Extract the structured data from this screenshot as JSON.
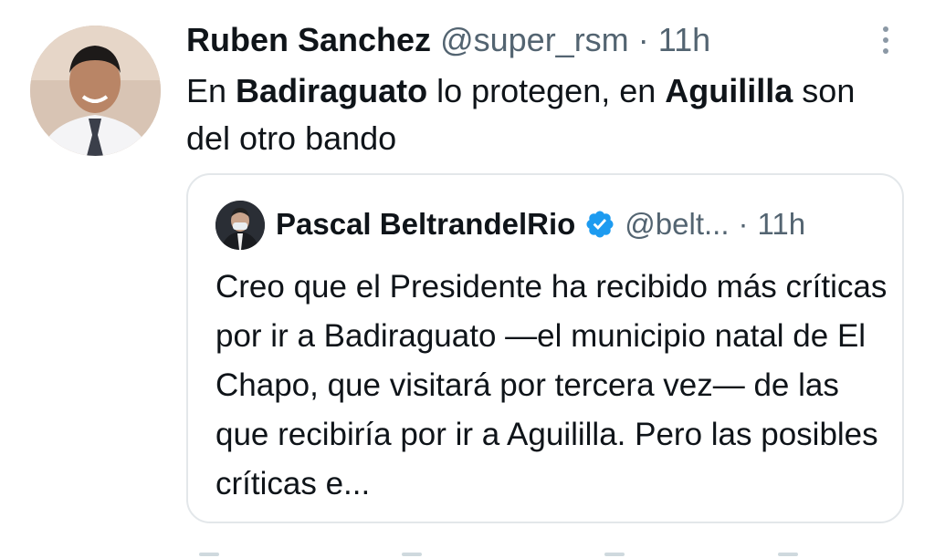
{
  "tweet": {
    "author_name": "Ruben Sanchez",
    "author_handle": "@super_rsm",
    "separator": "·",
    "time": "11h",
    "text_parts": [
      "En ",
      "Badiraguato",
      " lo protegen, en ",
      "Aguililla",
      " son del otro bando"
    ]
  },
  "quoted": {
    "author_name": "Pascal BeltrandelRio",
    "author_handle": "@belt...",
    "separator": "·",
    "time": "11h",
    "text": "Creo que el Presidente ha recibido más críticas por ir a Badiraguato —el municipio natal de El Chapo, que visitará por tercera vez— de las que recibiría por ir a Aguililla. Pero las posibles críticas e..."
  },
  "icons": {
    "more": "more-vertical-icon",
    "verified": "verified-badge-icon"
  },
  "colors": {
    "text_primary": "#0f1419",
    "text_secondary": "#536471",
    "verified_blue": "#1d9bf0",
    "border": "#e3e7ea"
  }
}
